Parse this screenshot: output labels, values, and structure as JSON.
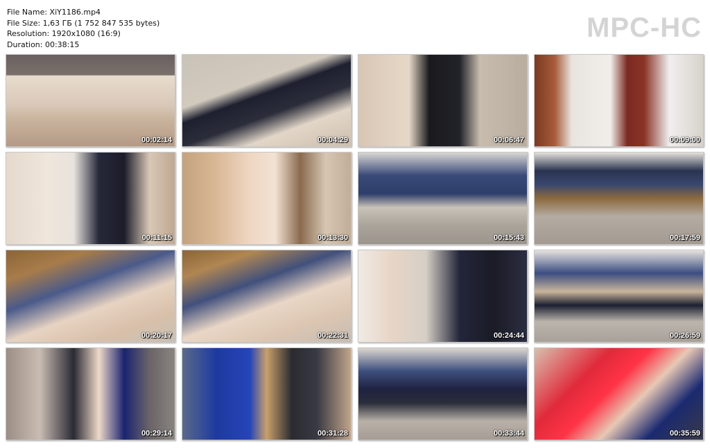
{
  "file_info": {
    "file_name": "File Name: XiY1186.mp4",
    "file_size": "File Size: 1,63 ГБ (1 752 847 535 bytes)",
    "resolution": "Resolution: 1920x1080 (16:9)",
    "duration": "Duration: 00:38:15"
  },
  "brand": "MPC-HC",
  "thumbnails": [
    {
      "timestamp": "00:02:14"
    },
    {
      "timestamp": "00:04:29"
    },
    {
      "timestamp": "00:06:47"
    },
    {
      "timestamp": "00:09:00"
    },
    {
      "timestamp": "00:11:15"
    },
    {
      "timestamp": "00:13:30"
    },
    {
      "timestamp": "00:15:43"
    },
    {
      "timestamp": "00:17:59"
    },
    {
      "timestamp": "00:20:17"
    },
    {
      "timestamp": "00:22:31"
    },
    {
      "timestamp": "00:24:44"
    },
    {
      "timestamp": "00:26:59"
    },
    {
      "timestamp": "00:29:14"
    },
    {
      "timestamp": "00:31:28"
    },
    {
      "timestamp": "00:33:44"
    },
    {
      "timestamp": "00:35:59"
    }
  ]
}
